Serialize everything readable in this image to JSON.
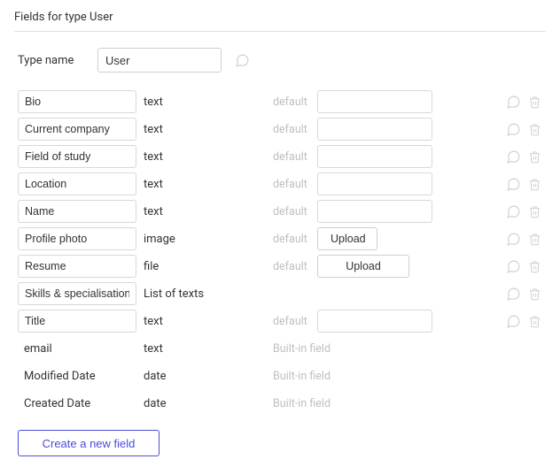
{
  "header": {
    "title": "Fields for type User"
  },
  "type_name": {
    "label": "Type name",
    "value": "User"
  },
  "labels": {
    "default": "default",
    "builtin": "Built-in field",
    "upload": "Upload",
    "create": "Create a new field"
  },
  "fields": [
    {
      "name": "Bio",
      "type": "text",
      "default_kind": "input",
      "default_value": ""
    },
    {
      "name": "Current company",
      "type": "text",
      "default_kind": "input",
      "default_value": ""
    },
    {
      "name": "Field of study",
      "type": "text",
      "default_kind": "input",
      "default_value": ""
    },
    {
      "name": "Location",
      "type": "text",
      "default_kind": "input",
      "default_value": ""
    },
    {
      "name": "Name",
      "type": "text",
      "default_kind": "input",
      "default_value": ""
    },
    {
      "name": "Profile photo",
      "type": "image",
      "default_kind": "upload_small",
      "default_value": ""
    },
    {
      "name": "Resume",
      "type": "file",
      "default_kind": "upload_wide",
      "default_value": ""
    },
    {
      "name": "Skills & specialisation",
      "type": "List of texts",
      "default_kind": "none",
      "default_value": ""
    },
    {
      "name": "Title",
      "type": "text",
      "default_kind": "input",
      "default_value": ""
    }
  ],
  "builtin_fields": [
    {
      "name": "email",
      "type": "text"
    },
    {
      "name": "Modified Date",
      "type": "date"
    },
    {
      "name": "Created Date",
      "type": "date"
    }
  ]
}
